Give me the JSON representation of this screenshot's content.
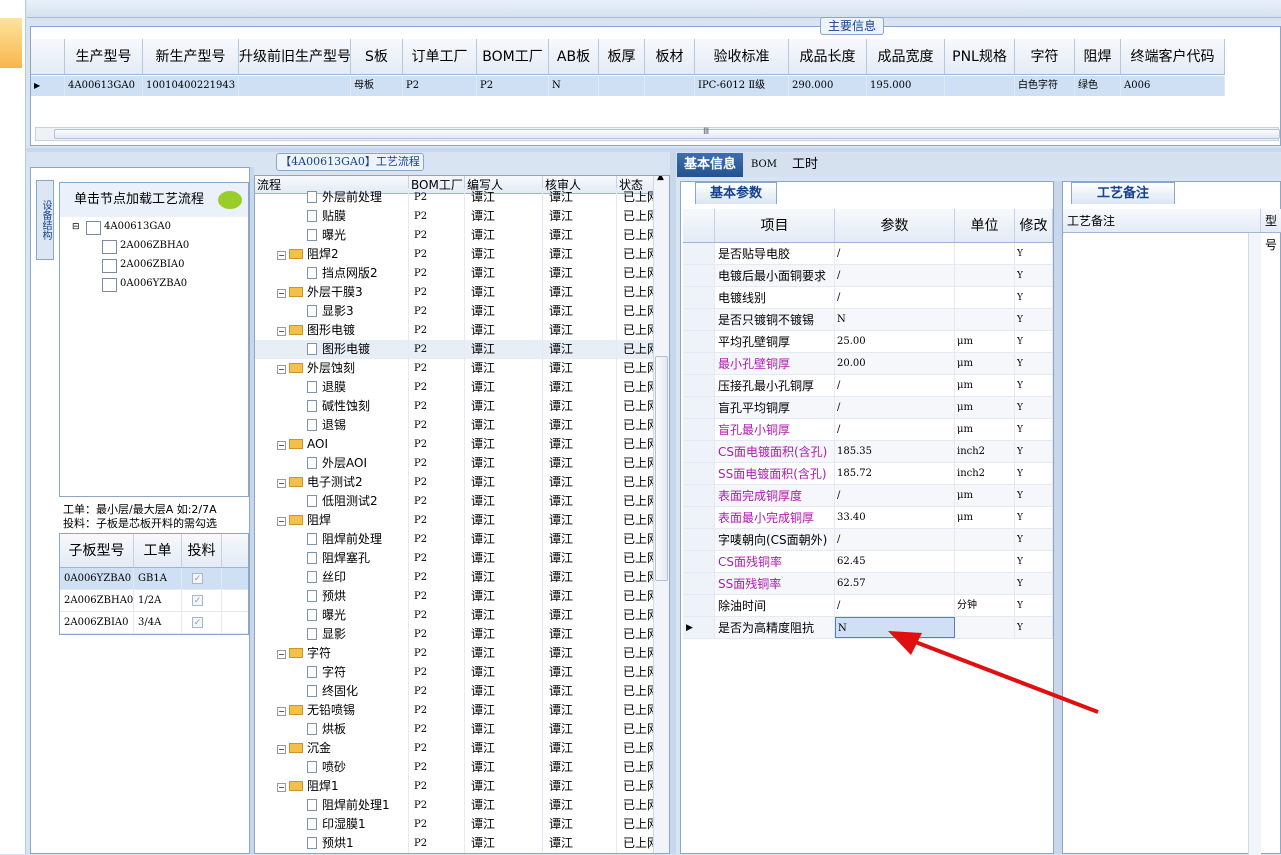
{
  "main_info": {
    "title": "主要信息",
    "columns": [
      "生产型号",
      "新生产型号",
      "升级前旧生产型号",
      "S板",
      "订单工厂",
      "BOM工厂",
      "AB板",
      "板厚",
      "板材",
      "验收标准",
      "成品长度",
      "成品宽度",
      "PNL规格",
      "字符",
      "阻焊",
      "终端客户代码"
    ],
    "row": [
      "4A00613GA0",
      "10010400221943",
      "",
      "母板",
      "P2",
      "P2",
      "N",
      "",
      "",
      "IPC-6012 Ⅱ级",
      "290.000",
      "195.000",
      "",
      "白色字符",
      "绿色",
      "A006"
    ],
    "scroll_mark": "Ⅲ"
  },
  "left": {
    "vtab": "设备结构",
    "hint": "单击节点加载工艺流程",
    "tree": {
      "root": "4A00613GA0",
      "children": [
        "2A006ZBHA0",
        "2A006ZBIA0",
        "0A006YZBA0"
      ]
    },
    "info": [
      "工单：最小层/最大层A 如:2/7A",
      "投料：子板是芯板开料的需勾选"
    ],
    "sub_columns": [
      "子板型号",
      "工单",
      "投料"
    ],
    "sub_rows": [
      [
        "0A006YZBA0",
        "GB1A"
      ],
      [
        "2A006ZBHA0",
        "1/2A"
      ],
      [
        "2A006ZBIA0",
        "3/4A"
      ]
    ]
  },
  "flow": {
    "title": "【4A00613GA0】工艺流程",
    "columns": [
      "流程",
      "BOM工厂",
      "编写人",
      "核审人",
      "状态"
    ],
    "rows": [
      {
        "name": "外层前处理",
        "type": "doc",
        "bom": "P2",
        "w": "谭江",
        "r": "谭江",
        "s": "已上网"
      },
      {
        "name": "贴膜",
        "type": "doc",
        "bom": "P2",
        "w": "谭江",
        "r": "谭江",
        "s": "已上网"
      },
      {
        "name": "曝光",
        "type": "doc",
        "bom": "P2",
        "w": "谭江",
        "r": "谭江",
        "s": "已上网"
      },
      {
        "name": "阻焊2",
        "type": "folder",
        "bom": "P2",
        "w": "谭江",
        "r": "谭江",
        "s": "已上网"
      },
      {
        "name": "挡点网版2",
        "type": "doc",
        "bom": "P2",
        "w": "谭江",
        "r": "谭江",
        "s": "已上网"
      },
      {
        "name": "外层干膜3",
        "type": "folder",
        "bom": "P2",
        "w": "谭江",
        "r": "谭江",
        "s": "已上网"
      },
      {
        "name": "显影3",
        "type": "doc",
        "bom": "P2",
        "w": "谭江",
        "r": "谭江",
        "s": "已上网"
      },
      {
        "name": "图形电镀",
        "type": "folder",
        "bom": "P2",
        "w": "谭江",
        "r": "谭江",
        "s": "已上网"
      },
      {
        "name": "图形电镀",
        "type": "doc",
        "bom": "P2",
        "w": "谭江",
        "r": "谭江",
        "s": "已上网"
      },
      {
        "name": "外层蚀刻",
        "type": "folder",
        "bom": "P2",
        "w": "谭江",
        "r": "谭江",
        "s": "已上网"
      },
      {
        "name": "退膜",
        "type": "doc",
        "bom": "P2",
        "w": "谭江",
        "r": "谭江",
        "s": "已上网"
      },
      {
        "name": "碱性蚀刻",
        "type": "doc",
        "bom": "P2",
        "w": "谭江",
        "r": "谭江",
        "s": "已上网"
      },
      {
        "name": "退锡",
        "type": "doc",
        "bom": "P2",
        "w": "谭江",
        "r": "谭江",
        "s": "已上网"
      },
      {
        "name": "AOI",
        "type": "folder",
        "bom": "P2",
        "w": "谭江",
        "r": "谭江",
        "s": "已上网"
      },
      {
        "name": "外层AOI",
        "type": "doc",
        "bom": "P2",
        "w": "谭江",
        "r": "谭江",
        "s": "已上网"
      },
      {
        "name": "电子测试2",
        "type": "folder",
        "bom": "P2",
        "w": "谭江",
        "r": "谭江",
        "s": "已上网"
      },
      {
        "name": "低阻测试2",
        "type": "doc",
        "bom": "P2",
        "w": "谭江",
        "r": "谭江",
        "s": "已上网"
      },
      {
        "name": "阻焊",
        "type": "folder",
        "bom": "P2",
        "w": "谭江",
        "r": "谭江",
        "s": "已上网"
      },
      {
        "name": "阻焊前处理",
        "type": "doc",
        "bom": "P2",
        "w": "谭江",
        "r": "谭江",
        "s": "已上网"
      },
      {
        "name": "阻焊塞孔",
        "type": "doc",
        "bom": "P2",
        "w": "谭江",
        "r": "谭江",
        "s": "已上网"
      },
      {
        "name": "丝印",
        "type": "doc",
        "bom": "P2",
        "w": "谭江",
        "r": "谭江",
        "s": "已上网"
      },
      {
        "name": "预烘",
        "type": "doc",
        "bom": "P2",
        "w": "谭江",
        "r": "谭江",
        "s": "已上网"
      },
      {
        "name": "曝光",
        "type": "doc",
        "bom": "P2",
        "w": "谭江",
        "r": "谭江",
        "s": "已上网"
      },
      {
        "name": "显影",
        "type": "doc",
        "bom": "P2",
        "w": "谭江",
        "r": "谭江",
        "s": "已上网"
      },
      {
        "name": "字符",
        "type": "folder",
        "bom": "P2",
        "w": "谭江",
        "r": "谭江",
        "s": "已上网"
      },
      {
        "name": "字符",
        "type": "doc",
        "bom": "P2",
        "w": "谭江",
        "r": "谭江",
        "s": "已上网"
      },
      {
        "name": "终固化",
        "type": "doc",
        "bom": "P2",
        "w": "谭江",
        "r": "谭江",
        "s": "已上网"
      },
      {
        "name": "无铅喷锡",
        "type": "folder",
        "bom": "P2",
        "w": "谭江",
        "r": "谭江",
        "s": "已上网"
      },
      {
        "name": "烘板",
        "type": "doc",
        "bom": "P2",
        "w": "谭江",
        "r": "谭江",
        "s": "已上网"
      },
      {
        "name": "沉金",
        "type": "folder",
        "bom": "P2",
        "w": "谭江",
        "r": "谭江",
        "s": "已上网"
      },
      {
        "name": "喷砂",
        "type": "doc",
        "bom": "P2",
        "w": "谭江",
        "r": "谭江",
        "s": "已上网"
      },
      {
        "name": "阻焊1",
        "type": "folder",
        "bom": "P2",
        "w": "谭江",
        "r": "谭江",
        "s": "已上网"
      },
      {
        "name": "阻焊前处理1",
        "type": "doc",
        "bom": "P2",
        "w": "谭江",
        "r": "谭江",
        "s": "已上网"
      },
      {
        "name": "印湿膜1",
        "type": "doc",
        "bom": "P2",
        "w": "谭江",
        "r": "谭江",
        "s": "已上网"
      },
      {
        "name": "预烘1",
        "type": "doc",
        "bom": "P2",
        "w": "谭江",
        "r": "谭江",
        "s": "已上网"
      }
    ]
  },
  "right": {
    "tabs": [
      "基本信息",
      "BOM",
      "工时"
    ],
    "basic_tab": "基本参数",
    "param_columns": [
      "项目",
      "参数",
      "单位",
      "修改"
    ],
    "params": [
      {
        "n": "是否贴导电胶",
        "v": "/",
        "u": "",
        "m": "Y",
        "pink": false
      },
      {
        "n": "电镀后最小面铜要求",
        "v": "/",
        "u": "",
        "m": "Y",
        "pink": false
      },
      {
        "n": "电镀线别",
        "v": "/",
        "u": "",
        "m": "Y",
        "pink": false
      },
      {
        "n": "是否只镀铜不镀锡",
        "v": "N",
        "u": "",
        "m": "Y",
        "pink": false
      },
      {
        "n": "平均孔壁铜厚",
        "v": "25.00",
        "u": "μm",
        "m": "Y",
        "pink": false
      },
      {
        "n": "最小孔壁铜厚",
        "v": "20.00",
        "u": "μm",
        "m": "Y",
        "pink": true
      },
      {
        "n": "压接孔最小孔铜厚",
        "v": "/",
        "u": "μm",
        "m": "Y",
        "pink": false
      },
      {
        "n": "盲孔平均铜厚",
        "v": "/",
        "u": "μm",
        "m": "Y",
        "pink": false
      },
      {
        "n": "盲孔最小铜厚",
        "v": "/",
        "u": "μm",
        "m": "Y",
        "pink": true
      },
      {
        "n": "CS面电镀面积(含孔)",
        "v": "185.35",
        "u": "inch2",
        "m": "Y",
        "pink": true
      },
      {
        "n": "SS面电镀面积(含孔)",
        "v": "185.72",
        "u": "inch2",
        "m": "Y",
        "pink": true
      },
      {
        "n": "表面完成铜厚度",
        "v": "/",
        "u": "μm",
        "m": "Y",
        "pink": true
      },
      {
        "n": "表面最小完成铜厚",
        "v": "33.40",
        "u": "μm",
        "m": "Y",
        "pink": true
      },
      {
        "n": "字唛朝向(CS面朝外)",
        "v": "/",
        "u": "",
        "m": "Y",
        "pink": false
      },
      {
        "n": "CS面残铜率",
        "v": "62.45",
        "u": "",
        "m": "Y",
        "pink": true
      },
      {
        "n": "SS面残铜率",
        "v": "62.57",
        "u": "",
        "m": "Y",
        "pink": true
      },
      {
        "n": "除油时间",
        "v": "/",
        "u": "分钟",
        "m": "Y",
        "pink": false
      },
      {
        "n": "是否为高精度阻抗",
        "v": "N",
        "u": "",
        "m": "Y",
        "pink": false
      }
    ],
    "remark_tab": "工艺备注",
    "remark_columns": [
      "工艺备注",
      "型号"
    ]
  }
}
